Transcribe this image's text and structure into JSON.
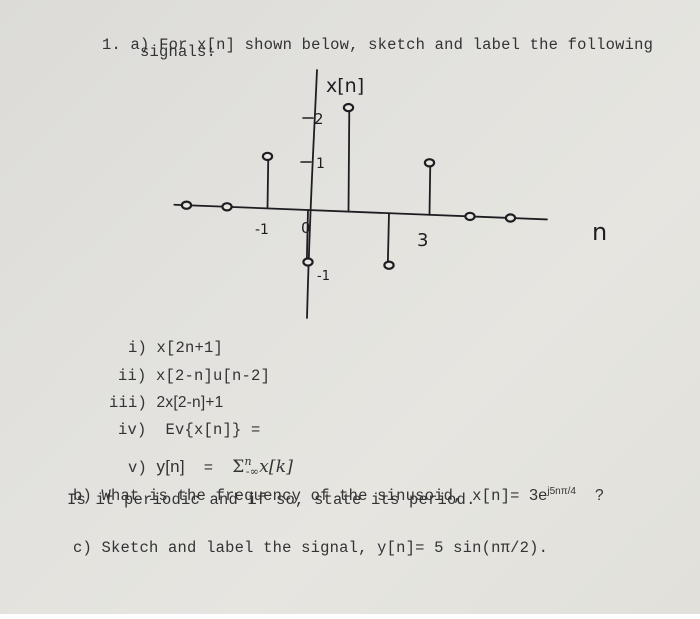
{
  "problem": {
    "number": "1.",
    "part_a": {
      "label": "a)",
      "text_line1": "For x[n] shown below, sketch and label the following",
      "text_line2": "signals:",
      "items": [
        {
          "label": "i)",
          "expr": "x[2n+1]"
        },
        {
          "label": "ii)",
          "expr": "x[2-n]u[n-2]"
        },
        {
          "label": "iii)",
          "expr": "2x[2-n]+1"
        },
        {
          "label": "iv)",
          "expr": "Ev{x[n]} ="
        },
        {
          "label": "v)",
          "expr_left": "y[n]",
          "equals": "=",
          "sum_symbol": "Σ",
          "sum_upper": "n",
          "sum_lower": "-∞",
          "sum_term": "x[k]"
        }
      ]
    },
    "part_b": {
      "label": "b)",
      "line1_text": "What is the frequency of the sinusoid,",
      "line1_expr": "x[n]=",
      "line1_coef": "3e",
      "line1_exponent": "j5nπ/4",
      "line1_end": "?",
      "line2_text": "Is it periodic and if so, state its period."
    },
    "part_c": {
      "label": "c)",
      "text": "Sketch and label the signal,",
      "expr": "y[n]= 5 sin(nπ/2)."
    }
  },
  "sketch": {
    "signal_label": "x[n]",
    "axis_label": "n",
    "tick_labels": {
      "y_2": "2",
      "y_1": "1",
      "y_neg1": "-1",
      "x_neg1": "-1",
      "x_0": "0",
      "x_3": "3"
    },
    "stems": [
      {
        "n": -3,
        "value": 0
      },
      {
        "n": -2,
        "value": 0
      },
      {
        "n": -1,
        "value": 1
      },
      {
        "n": 0,
        "value": -1
      },
      {
        "n": 1,
        "value": 2
      },
      {
        "n": 2,
        "value": -1
      },
      {
        "n": 3,
        "value": 1
      },
      {
        "n": 4,
        "value": 0
      },
      {
        "n": 5,
        "value": 0
      }
    ],
    "ink_color": "#1e1e22"
  }
}
